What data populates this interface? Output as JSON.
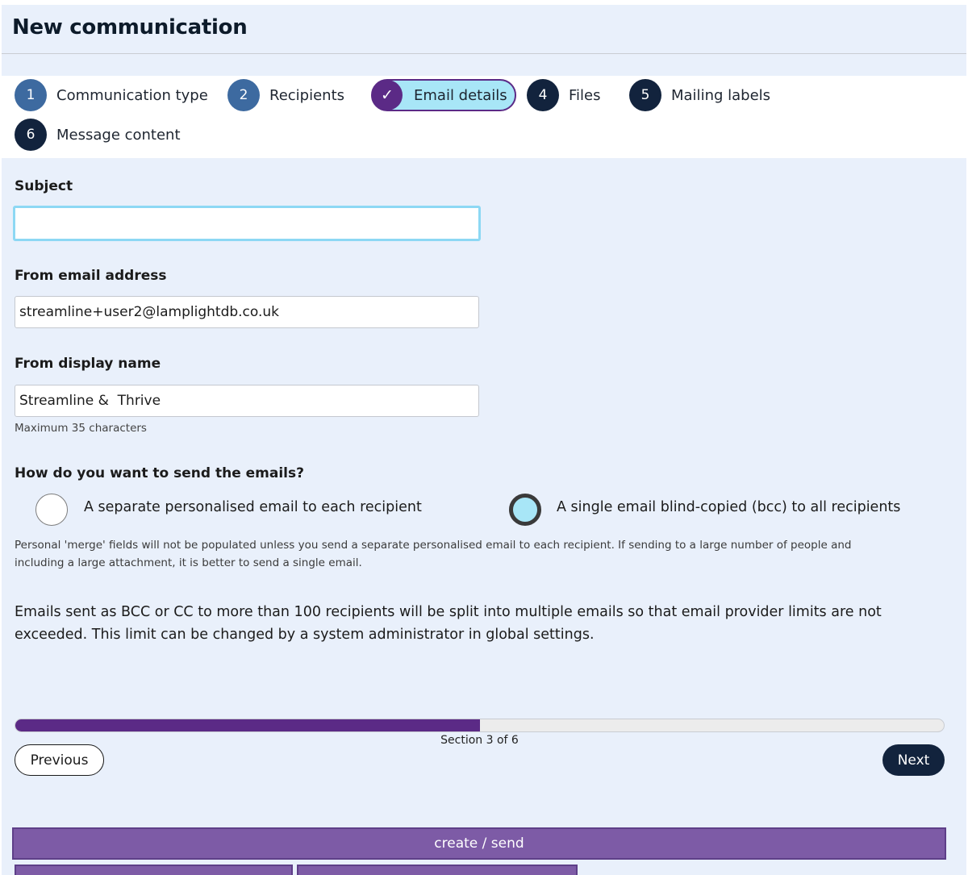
{
  "page": {
    "title": "New communication"
  },
  "steps": [
    {
      "number": "1",
      "label": "Communication type",
      "state": "done"
    },
    {
      "number": "2",
      "label": "Recipients",
      "state": "done"
    },
    {
      "number": "✓",
      "label": "Email details",
      "state": "active"
    },
    {
      "number": "4",
      "label": "Files",
      "state": "todo"
    },
    {
      "number": "5",
      "label": "Mailing labels",
      "state": "todo"
    },
    {
      "number": "6",
      "label": "Message content",
      "state": "todo"
    }
  ],
  "form": {
    "subject": {
      "label": "Subject",
      "value": ""
    },
    "from_email": {
      "label": "From email address",
      "value": "streamline+user2@lamplightdb.co.uk"
    },
    "from_name": {
      "label": "From display name",
      "value": "Streamline &  Thrive",
      "hint": "Maximum 35 characters"
    },
    "send_mode": {
      "question": "How do you want to send the emails?",
      "options": [
        {
          "label": "A separate personalised email to each recipient",
          "selected": false
        },
        {
          "label": "A single email blind-copied (bcc) to all recipients",
          "selected": true
        }
      ],
      "help": "Personal 'merge' fields will not be populated unless you send a separate personalised email to each recipient. If sending to a large number of people and including a large attachment, it is better to send a single email."
    },
    "info": "Emails sent as BCC or CC to more than 100 recipients will be split into multiple emails so that email provider limits are not exceeded. This limit can be changed by a system administrator in global settings."
  },
  "progress": {
    "fraction": 0.5,
    "text": "Section 3 of 6"
  },
  "nav": {
    "previous": "Previous",
    "next": "Next"
  },
  "actions": {
    "create_send": "create / send"
  },
  "colors": {
    "accent_purple": "#5b2a86",
    "active_step_fill": "#a8e6f7",
    "navy": "#12233d",
    "page_bg": "#e9f0fb",
    "button_purple": "#7d5ba6"
  }
}
